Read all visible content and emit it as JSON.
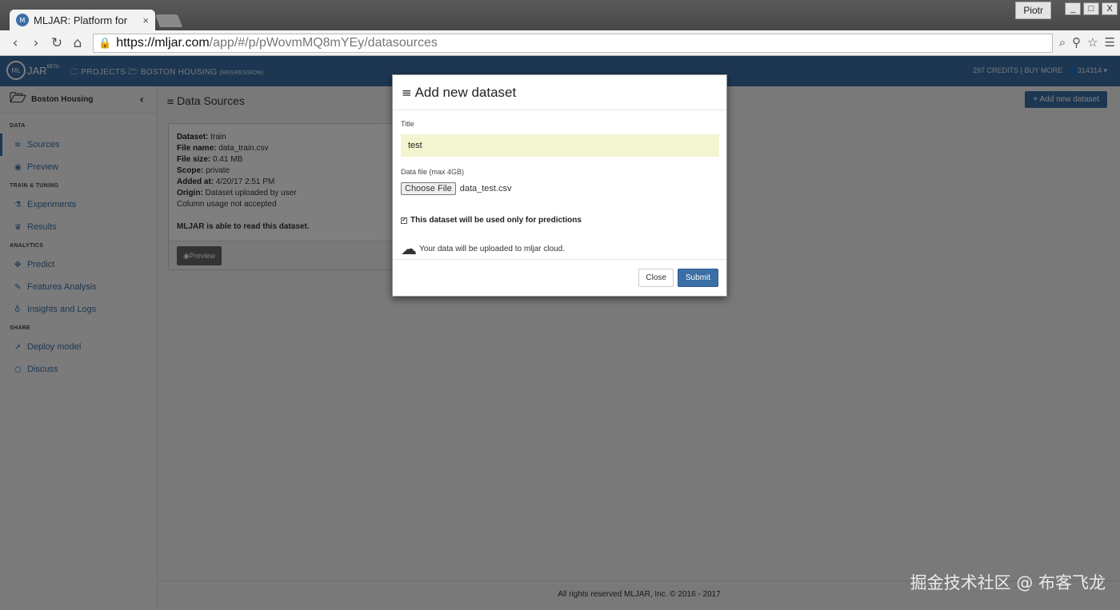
{
  "browser": {
    "tab_title": "MLJAR: Platform for",
    "tab_close": "×",
    "user": "Piotr",
    "url_host": "https://mljar.com",
    "url_path": "/app/#/p/pWovmMQ8mYEy/datasources",
    "win_buttons": [
      "_",
      "□",
      "X"
    ]
  },
  "header": {
    "logo": "JAR",
    "logo_mark": "ML",
    "logo_beta": "BETA",
    "projects_link": "PROJECTS",
    "project_link": "BOSTON HOUSING",
    "project_tag": "(REGRESSION)",
    "credits": "297 CREDITS | BUY MORE",
    "user_id": "314314"
  },
  "sidebar": {
    "project_name": "Boston Housing",
    "sections": {
      "data": "DATA",
      "train": "TRAIN & TUNING",
      "analytics": "ANALYTICS",
      "share": "SHARE"
    },
    "items": {
      "sources": "Sources",
      "preview": "Preview",
      "experiments": "Experiments",
      "results": "Results",
      "predict": "Predict",
      "features": "Features Analysis",
      "insights": "Insights and Logs",
      "deploy": "Deploy model",
      "discuss": "Discuss"
    }
  },
  "main": {
    "title": "Data Sources",
    "add_button": "Add new dataset",
    "dataset": {
      "dataset_label": "Dataset:",
      "dataset_value": "train",
      "filename_label": "File name:",
      "filename_value": "data_train.csv",
      "filesize_label": "File size:",
      "filesize_value": "0.41 MB",
      "scope_label": "Scope:",
      "scope_value": "private",
      "added_label": "Added at:",
      "added_value": "4/20/17 2:51 PM",
      "origin_label": "Origin:",
      "origin_value": "Dataset uploaded by user",
      "column_usage": "Column usage not accepted",
      "readable": "MLJAR is able to read this dataset.",
      "preview_button": "Preview"
    }
  },
  "modal": {
    "title": "Add new dataset",
    "title_label": "Title",
    "title_value": "test",
    "file_label": "Data file (max 4GB)",
    "choose_button": "Choose File",
    "file_name": "data_test.csv",
    "checkbox_label": "This dataset will be used only for predictions",
    "cloud_note": "Your data will be uploaded to mljar cloud.",
    "close_button": "Close",
    "submit_button": "Submit"
  },
  "footer": {
    "text": "All rights reserved MLJAR, Inc. © 2016 - 2017"
  },
  "watermark": "掘金技术社区 @ 布客飞龙"
}
